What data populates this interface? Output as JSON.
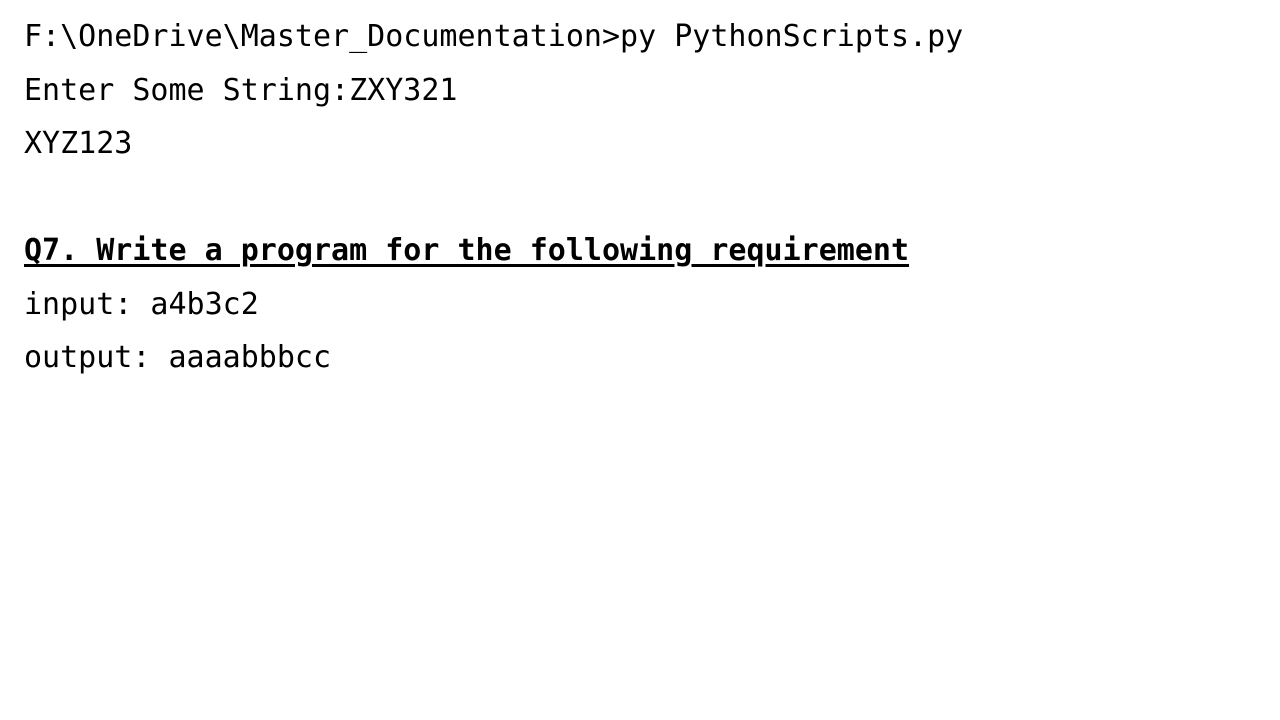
{
  "console": {
    "command_line": "F:\\OneDrive\\Master_Documentation>py PythonScripts.py",
    "prompt_line": "Enter Some String:ZXY321",
    "result_line": "XYZ123"
  },
  "question": {
    "heading": "Q7. Write a program for the following requirement",
    "input_line": "input: a4b3c2",
    "output_line": "output: aaaabbbcc"
  }
}
